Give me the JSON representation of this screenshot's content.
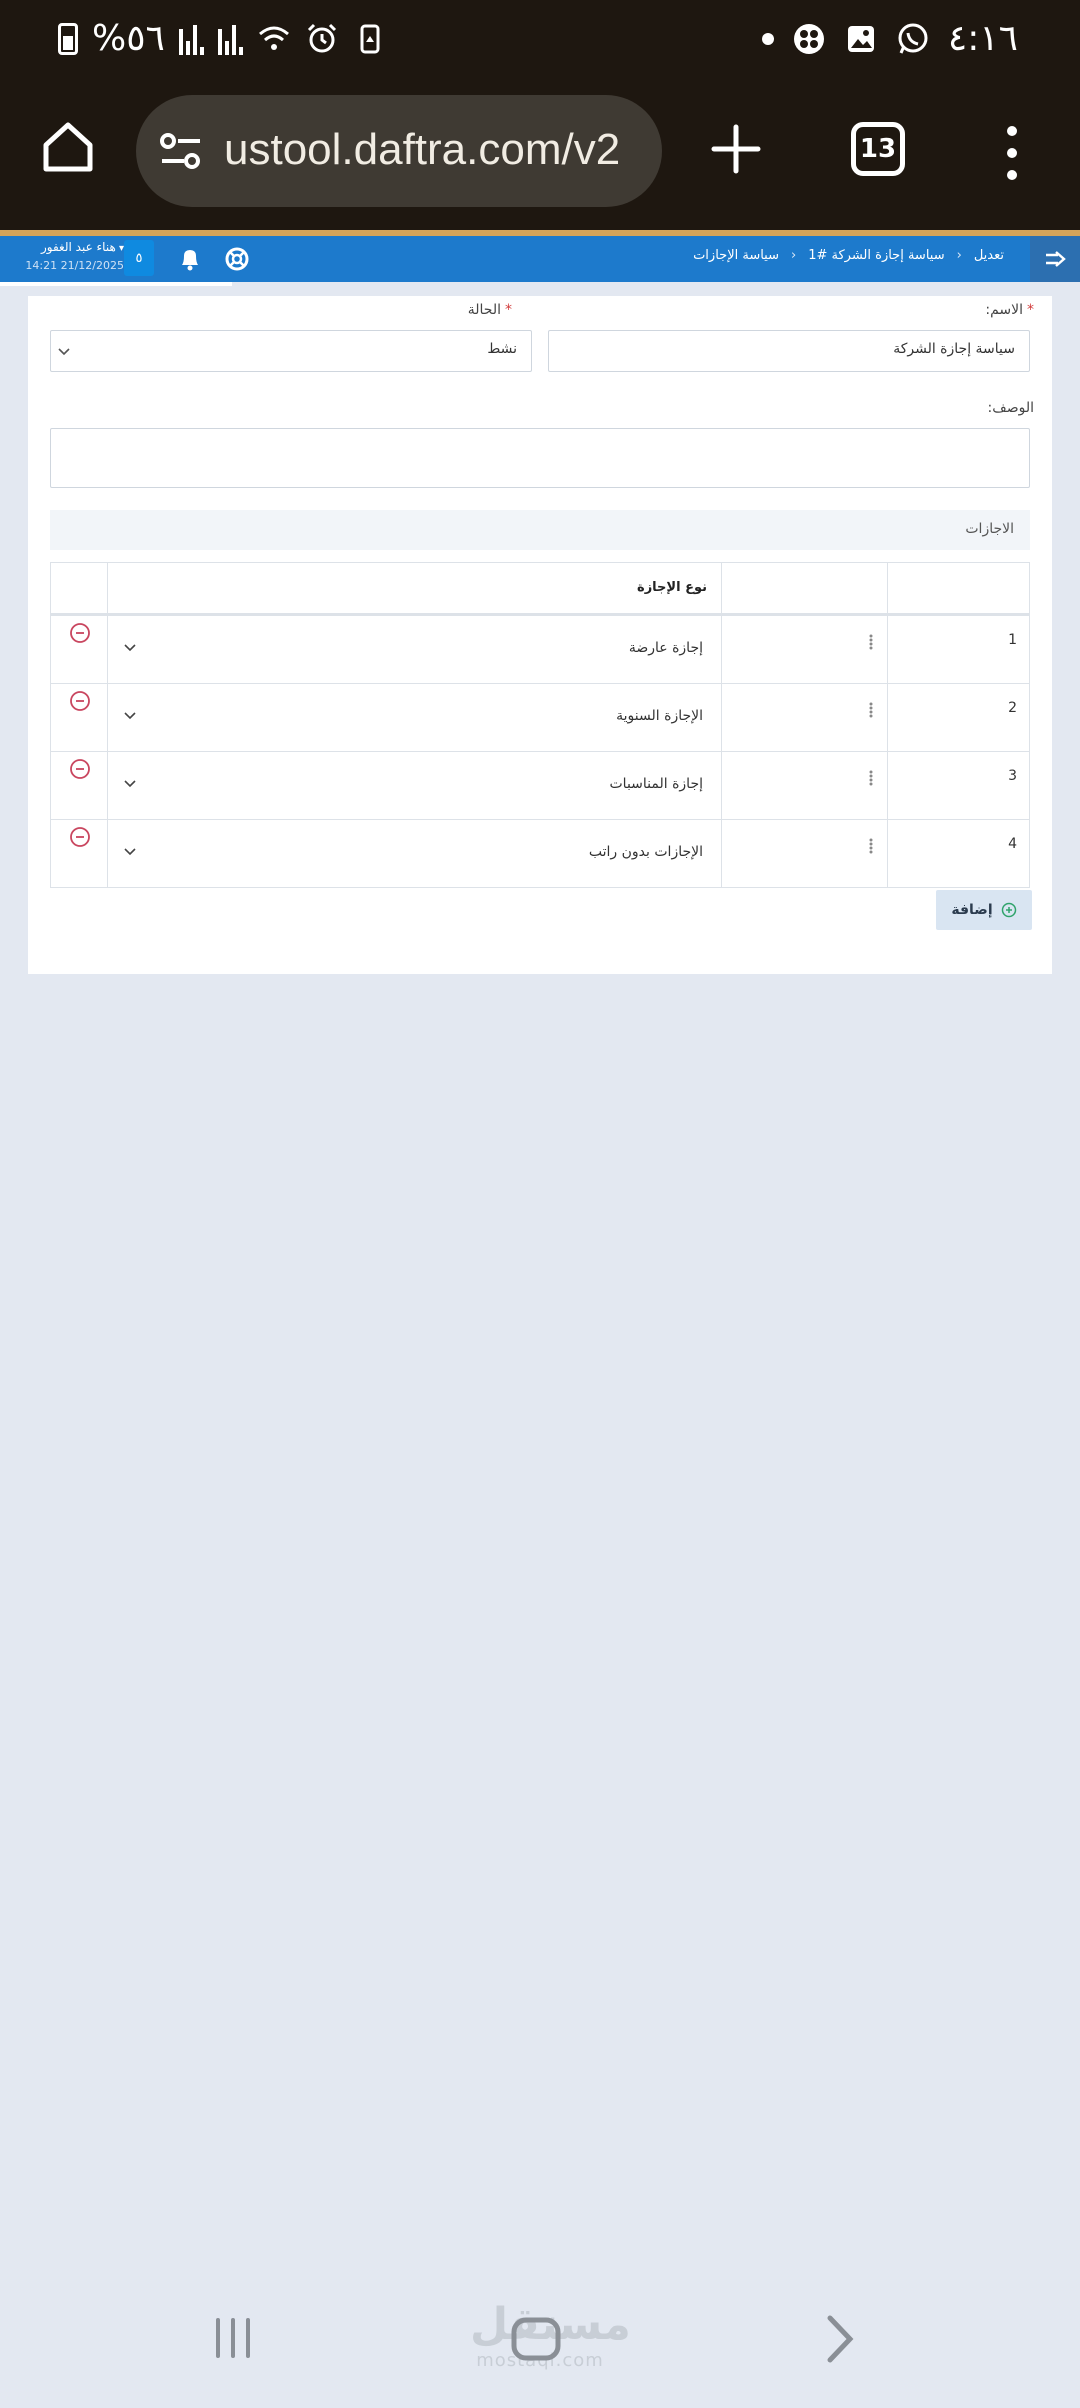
{
  "status_bar": {
    "time": "٤:١٦",
    "battery": "%٥٦"
  },
  "browser": {
    "url": "ustool.daftra.com/v2",
    "tab_count": "13"
  },
  "header": {
    "breadcrumb": [
      "سياسة الإجازات",
      "سياسة إجازة الشركة #1",
      "تعديل"
    ],
    "notification_badge": "٥",
    "user_name": "هناء عبد الغفور",
    "datetime": "14:21 21/12/2025"
  },
  "form": {
    "name_label": "الاسم:",
    "name_value": "سياسة إجازة الشركة",
    "status_label": "الحالة",
    "status_value": "نشط",
    "description_label": "الوصف:",
    "description_value": "",
    "section_title": "الاجازات",
    "table": {
      "header_type": "نوع الإجازة",
      "rows": [
        {
          "num": "1",
          "type": "إجازة عارضة"
        },
        {
          "num": "2",
          "type": "الإجازة السنوية"
        },
        {
          "num": "3",
          "type": "إجازة المناسبات"
        },
        {
          "num": "4",
          "type": "الإجازات بدون راتب"
        }
      ]
    },
    "add_label": "إضافة"
  },
  "watermark": {
    "text": "مستقل",
    "sub": "mostaql.com"
  },
  "colors": {
    "header_blue": "#1d7acc",
    "page_bg": "#e3e8f1",
    "chrome_bg": "#1e1710",
    "remove_red": "#c9465f",
    "add_green": "#2fa36b"
  }
}
